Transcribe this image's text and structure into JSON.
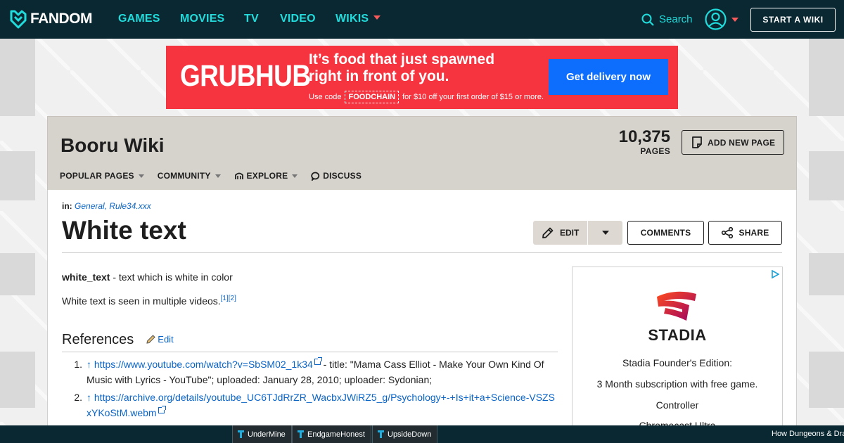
{
  "topnav": {
    "logo_text": "FANDOM",
    "links": [
      "GAMES",
      "MOVIES",
      "TV",
      "VIDEO",
      "WIKIS"
    ],
    "search_label": "Search",
    "start_wiki_label": "START A WIKI"
  },
  "ad_banner": {
    "brand": "GRUBHUB",
    "headline": "It’s food that just spawned right in front of you.",
    "fine_prefix": "Use code",
    "promo_code": "FOODCHAIN",
    "fine_suffix": "for $10 off your first order of $15 or more.",
    "cta": "Get delivery now"
  },
  "wiki_header": {
    "title": "Booru Wiki",
    "page_count": "10,375",
    "page_count_label": "PAGES",
    "add_page_label": "ADD NEW PAGE",
    "nav": [
      "POPULAR PAGES",
      "COMMUNITY",
      "EXPLORE",
      "DISCUSS"
    ]
  },
  "article": {
    "categories_label": "in:",
    "categories": "General, Rule34.xxx",
    "title": "White text",
    "edit_label": "EDIT",
    "comments_label": "COMMENTS",
    "share_label": "SHARE",
    "definition_term": "white_text",
    "definition_text": " - text which is white in color",
    "paragraph": "White text is seen in multiple videos.",
    "footnotes": "[1][2]",
    "references_heading": "References",
    "references_edit": "Edit",
    "references": [
      {
        "num": "1.",
        "arrow": "↑",
        "url": "https://www.youtube.com/watch?v=SbSM02_1k34",
        "text": " - title: \"Mama Cass Elliot - Make Your Own Kind Of Music with Lyrics - YouTube\"; uploaded: January 28, 2010; uploader: Sydonian;"
      },
      {
        "num": "2.",
        "arrow": "↑",
        "url": "https://archive.org/details/youtube_UC6TJdRrZR_WacbxJWiRZ5_g/Psychology+-+Is+it+a+Science-VSZSxYKoStM.webm",
        "text": ""
      }
    ]
  },
  "side_ad": {
    "brand": "STADIA",
    "lines": [
      "Stadia Founder's Edition:",
      "3 Month subscription with free game.",
      "Controller",
      "Chromecast Ultra"
    ]
  },
  "bottombar": {
    "items": [
      "UnderMine",
      "EndgameHonest",
      "UpsideDown"
    ],
    "right_text": "How Dungeons & Dra"
  },
  "colors": {
    "nav_bg": "#0a2831",
    "nav_link": "#20dcdc",
    "accent_caret": "#fa5a5a",
    "ad_red": "#f63440",
    "ad_cta_blue": "#0d6efd",
    "link_blue": "#0a64c6",
    "wiki_header_bg": "#d6d2cc"
  }
}
